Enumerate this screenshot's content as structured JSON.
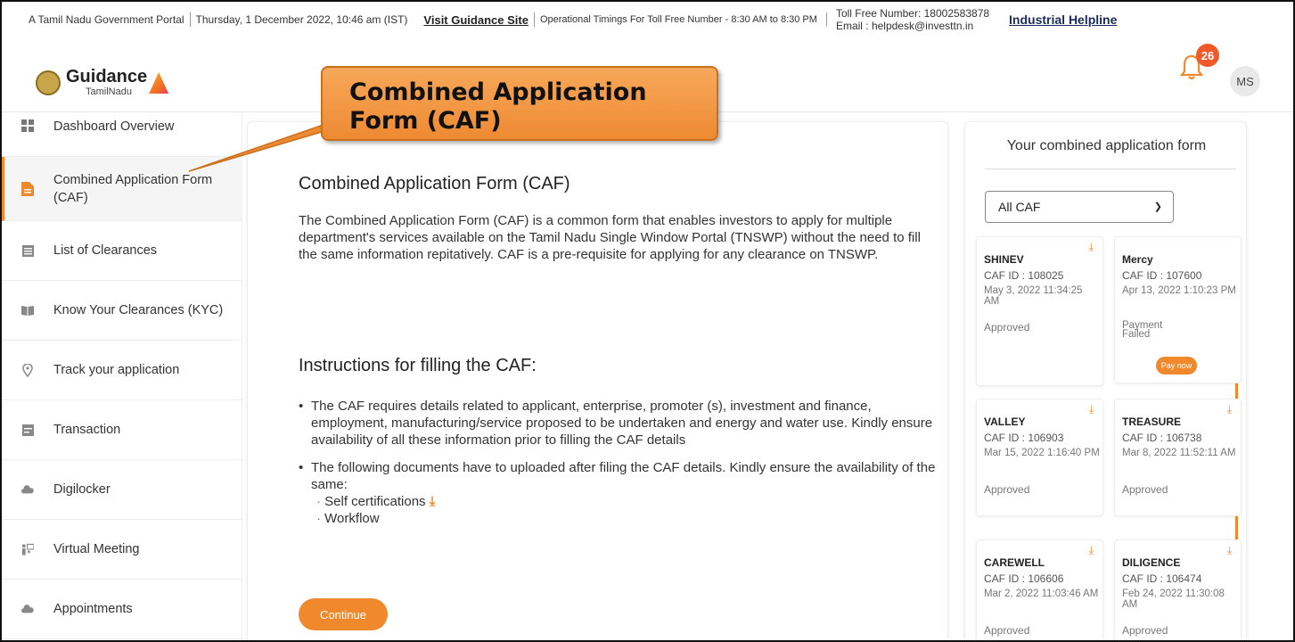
{
  "topbar": {
    "portal": "A Tamil Nadu Government Portal",
    "datetime": "Thursday, 1 December 2022, 10:46 am (IST)",
    "guidance_link": "Visit Guidance Site",
    "timings": "Operational Timings For Toll Free Number - 8:30 AM to 8:30 PM",
    "tollfree": "Toll Free Number: 18002583878",
    "email": "Email : helpdesk@investtn.in",
    "helpline": "Industrial Helpline"
  },
  "header": {
    "brand": "Guidance",
    "brand_sub": "TamilNadu",
    "notification_count": "26",
    "avatar_initials": "MS"
  },
  "callout": {
    "text": "Combined Application Form (CAF)"
  },
  "sidebar": {
    "items": [
      {
        "label": "Dashboard Overview",
        "icon": "grid-icon"
      },
      {
        "label": "Combined Application Form (CAF)",
        "icon": "document-icon",
        "active": true
      },
      {
        "label": "List of Clearances",
        "icon": "list-icon"
      },
      {
        "label": "Know Your Clearances (KYC)",
        "icon": "book-icon"
      },
      {
        "label": "Track your application",
        "icon": "location-icon"
      },
      {
        "label": "Transaction",
        "icon": "transaction-icon"
      },
      {
        "label": "Digilocker",
        "icon": "cloud-icon"
      },
      {
        "label": "Virtual Meeting",
        "icon": "meeting-icon"
      },
      {
        "label": "Appointments",
        "icon": "cloud-icon"
      }
    ]
  },
  "main": {
    "title": "Combined Application Form (CAF)",
    "description": "The Combined Application Form (CAF) is a common form that enables investors to apply for multiple department's services available on the Tamil Nadu Single Window Portal (TNSWP) without the need to fill the same information repitatively. CAF is a pre-requisite for applying for any clearance on TNSWP.",
    "instructions_title": "Instructions for filling the CAF:",
    "instruction_1": "The CAF requires details related to applicant, enterprise, promoter (s), investment and finance, employment, manufacturing/service proposed to be undertaken and energy and water use. Kindly ensure availability of all these information prior to filling the CAF details",
    "instruction_2": "The following documents have to uploaded after filing the CAF details. Kindly ensure the availability of the same:",
    "documents": [
      "Self certifications",
      "Workflow"
    ],
    "continue_label": "Continue"
  },
  "right_panel": {
    "title": "Your combined application form",
    "filter_selected": "All CAF",
    "cards": [
      {
        "name": "SHINEV",
        "caf_id": "CAF ID : 108025",
        "date": "May 3, 2022 11:34:25 AM",
        "status": "Approved"
      },
      {
        "name": "Mercy",
        "caf_id": "CAF ID : 107600",
        "date": "Apr 13, 2022 1:10:23 PM",
        "status": "Payment Failed",
        "action": "Pay now"
      },
      {
        "name": "VALLEY",
        "caf_id": "CAF ID : 106903",
        "date": "Mar 15, 2022 1:16:40 PM",
        "status": "Approved"
      },
      {
        "name": "TREASURE",
        "caf_id": "CAF ID : 106738",
        "date": "Mar 8, 2022 11:52:11 AM",
        "status": "Approved"
      },
      {
        "name": "CAREWELL",
        "caf_id": "CAF ID : 106606",
        "date": "Mar 2, 2022 11:03:46 AM",
        "status": "Approved"
      },
      {
        "name": "DILIGENCE",
        "caf_id": "CAF ID : 106474",
        "date": "Feb 24, 2022 11:30:08 AM",
        "status": "Approved"
      }
    ]
  },
  "colors": {
    "accent": "#f0892b",
    "badge": "#f05a28"
  }
}
